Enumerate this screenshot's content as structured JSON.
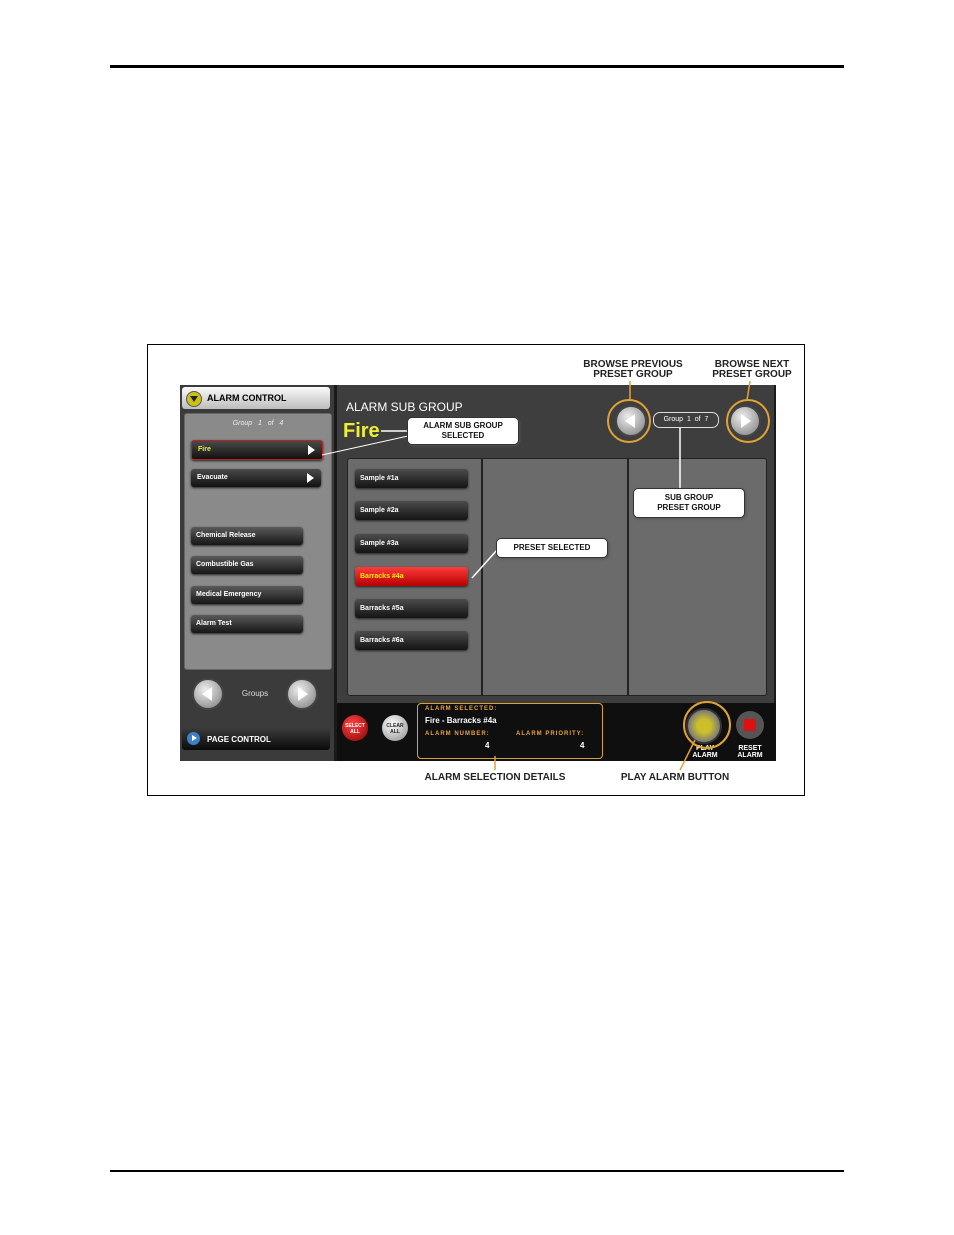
{
  "figure": {
    "callouts": {
      "browse_prev": "BROWSE PREVIOUS\nPRESET GROUP",
      "browse_next": "BROWSE NEXT\nPRESET GROUP",
      "subgroup_selected": "ALARM SUB GROUP\nSELECTED",
      "subgroup_preset_group": "SUB GROUP\nPRESET GROUP",
      "preset_selected": "PRESET SELECTED",
      "alarm_selection_details": "ALARM SELECTION DETAILS",
      "play_alarm_button": "PLAY ALARM BUTTON"
    }
  },
  "left": {
    "header": "ALARM CONTROL",
    "group_label": "Group",
    "group_current": "1",
    "group_of": "of",
    "group_total": "4",
    "subgroups": [
      {
        "label": "Fire",
        "selected": true
      },
      {
        "label": "Evacuate",
        "selected": false
      }
    ],
    "groups": [
      "Chemical Release",
      "Combustible Gas",
      "Medical Emergency",
      "Alarm Test"
    ],
    "groups_nav_label": "Groups",
    "page_control": "PAGE CONTROL"
  },
  "right": {
    "title": "ALARM SUB GROUP",
    "subgroup_name": "Fire",
    "preset_group_label": "Group",
    "preset_group_current": "1",
    "preset_group_of": "of",
    "preset_group_total": "7",
    "presets": [
      {
        "label": "Sample #1a",
        "selected": false
      },
      {
        "label": "Sample #2a",
        "selected": false
      },
      {
        "label": "Sample #3a",
        "selected": false
      },
      {
        "label": "Barracks #4a",
        "selected": true
      },
      {
        "label": "Barracks #5a",
        "selected": false
      },
      {
        "label": "Barracks #6a",
        "selected": false
      }
    ]
  },
  "bottom": {
    "select_all": "SELECT ALL",
    "clear_all": "CLEAR ALL",
    "alarm_selected_label": "ALARM SELECTED:",
    "alarm_selected_value": "Fire - Barracks #4a",
    "alarm_number_label": "ALARM NUMBER:",
    "alarm_number_value": "4",
    "alarm_priority_label": "ALARM PRIORITY:",
    "alarm_priority_value": "4",
    "play_alarm": "PLAY ALARM",
    "reset_alarm": "RESET ALARM"
  },
  "colors": {
    "accent_yellow": "#eeee33",
    "callout_orange": "#e0a233",
    "selected_red": "#d40000"
  }
}
